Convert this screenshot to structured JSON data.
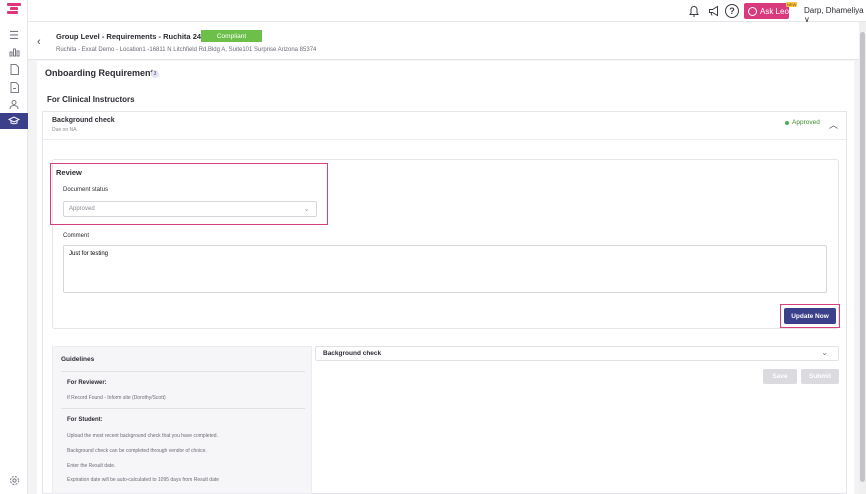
{
  "topbar": {
    "ask_label": "Ask Leo",
    "new_tag": "NEW",
    "user_name": "Darp, Dhameliya ∨"
  },
  "header": {
    "title": "Group Level - Requirements - Ruchita 24feb",
    "status_badge": "Compliant",
    "subtitle": "Ruchita - Exxat Demo - Location1 -16811 N Litchfield Rd,Bldg A, Suite101 Surprise Arizona 85374"
  },
  "main": {
    "title": "Onboarding Requirements",
    "count": "3",
    "section_title": "For Clinical Instructors"
  },
  "requirement": {
    "title": "Background check",
    "due": "Due on NA",
    "status": "Approved"
  },
  "review": {
    "title": "Review",
    "doc_status_label": "Document status",
    "doc_status_value": "Approved",
    "comment_label": "Comment",
    "comment_value": "Just for testing",
    "update_button": "Update Now"
  },
  "guidelines": {
    "title": "Guidelines",
    "reviewer_heading": "For Reviewer:",
    "reviewer_items": [
      "If Record Found - Inform site (Dorothy/Scott)"
    ],
    "student_heading": "For Student:",
    "student_items": [
      "Upload the most recent background check that you have completed.",
      "Background check can be completed through vendor of choice.",
      "Enter the Result date.",
      "Expiration date will be auto-calculated to 1095 days from Result date"
    ]
  },
  "submission": {
    "title": "Background check",
    "save_button": "Save",
    "submit_button": "Submit"
  }
}
